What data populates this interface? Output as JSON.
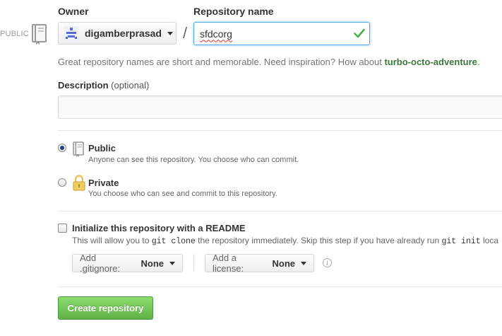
{
  "visibility_tag": "PUBLIC",
  "owner": {
    "label": "Owner",
    "name": "digamberprasad"
  },
  "separator": "/",
  "repository": {
    "label": "Repository name",
    "value": "sfdcorg"
  },
  "hint": {
    "text": "Great repository names are short and memorable. Need inspiration? How about ",
    "suggestion": "turbo-octo-adventure",
    "end": "."
  },
  "description": {
    "label": "Description",
    "optional": "(optional)",
    "value": ""
  },
  "visibility": {
    "selected": "public",
    "public": {
      "title": "Public",
      "subtitle": "Anyone can see this repository. You choose who can commit."
    },
    "private": {
      "title": "Private",
      "subtitle": "You choose who can see and commit to this repository."
    }
  },
  "readme": {
    "checked": false,
    "title": "Initialize this repository with a README",
    "sub_part1": "This will allow you to ",
    "sub_code1": "git clone",
    "sub_part2": " the repository immediately. Skip this step if you have already run ",
    "sub_code2": "git init",
    "sub_part3": " loca"
  },
  "gitignore": {
    "prefix": "Add .gitignore:",
    "value": "None"
  },
  "license": {
    "prefix": "Add a license:",
    "value": "None"
  },
  "create_button": "Create repository",
  "colors": {
    "accent_blue": "#51a7e8",
    "success_green": "#3c763d",
    "button_green": "#60b044",
    "check_green": "#4cae4c"
  }
}
